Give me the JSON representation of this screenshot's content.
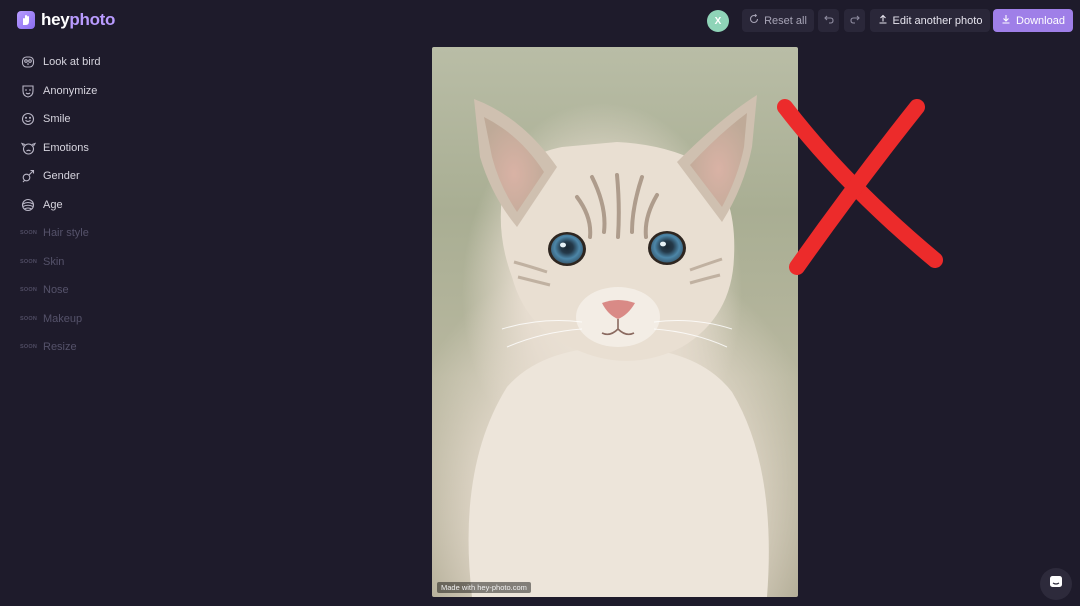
{
  "brand": {
    "name_part1": "hey",
    "name_part2": "photo"
  },
  "sidebar": {
    "items": [
      {
        "label": "Look at bird",
        "icon": "bird-look-icon",
        "soon": false
      },
      {
        "label": "Anonymize",
        "icon": "mask-icon",
        "soon": false
      },
      {
        "label": "Smile",
        "icon": "smile-icon",
        "soon": false
      },
      {
        "label": "Emotions",
        "icon": "emotions-icon",
        "soon": false
      },
      {
        "label": "Gender",
        "icon": "gender-icon",
        "soon": false
      },
      {
        "label": "Age",
        "icon": "age-icon",
        "soon": false
      },
      {
        "label": "Hair style",
        "icon": "",
        "soon": true
      },
      {
        "label": "Skin",
        "icon": "",
        "soon": true
      },
      {
        "label": "Nose",
        "icon": "",
        "soon": true
      },
      {
        "label": "Makeup",
        "icon": "",
        "soon": true
      },
      {
        "label": "Resize",
        "icon": "",
        "soon": true
      }
    ],
    "soon_label": "SOON"
  },
  "topbar": {
    "avatar_letter": "X",
    "reset_label": "Reset all",
    "edit_label": "Edit another photo",
    "download_label": "Download"
  },
  "photo": {
    "watermark": "Made with hey-photo.com"
  },
  "colors": {
    "background": "#1e1b2b",
    "accent": "#9f7fe8",
    "avatar": "#8fd4b8",
    "xmark": "#ec2b2b"
  }
}
